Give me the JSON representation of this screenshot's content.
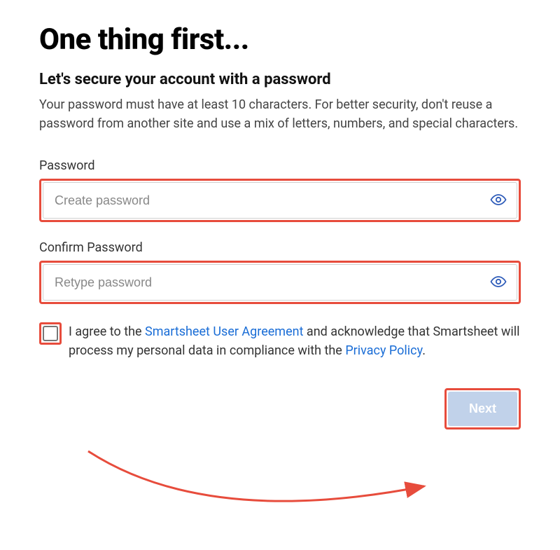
{
  "heading": "One thing first...",
  "subheading": "Let's secure your account with a password",
  "description": "Your password must have at least 10 characters. For better security, don't reuse a password from another site and use a mix of letters, numbers, and special characters.",
  "fields": {
    "password": {
      "label": "Password",
      "placeholder": "Create password",
      "value": ""
    },
    "confirm": {
      "label": "Confirm Password",
      "placeholder": "Retype password",
      "value": ""
    }
  },
  "consent": {
    "prefix": "I agree to the ",
    "link1": "Smartsheet User Agreement",
    "mid": " and acknowledge that Smartsheet will process my personal data in compliance with the ",
    "link2": "Privacy Policy",
    "suffix": "."
  },
  "button": {
    "next_label": "Next"
  },
  "colors": {
    "highlight": "#e74c3c",
    "link": "#1a6dd6",
    "button_bg": "#c1d2ea"
  }
}
